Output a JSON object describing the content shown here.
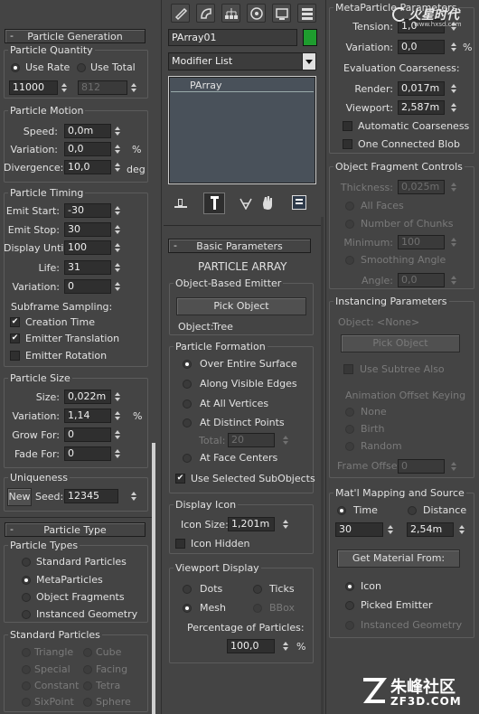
{
  "left": {
    "particle_generation": {
      "title": "Particle Generation"
    },
    "quantity": {
      "title": "Particle Quantity",
      "use_rate": "Use Rate",
      "use_total": "Use Total",
      "rate_value": "11000",
      "total_value": "812"
    },
    "motion": {
      "title": "Particle Motion",
      "speed_label": "Speed:",
      "speed": "0,0m",
      "variation_label": "Variation:",
      "variation": "0,0",
      "variation_unit": "%",
      "divergence_label": "Divergence:",
      "divergence": "10,0",
      "divergence_unit": "deg"
    },
    "timing": {
      "title": "Particle Timing",
      "emit_start_label": "Emit Start:",
      "emit_start": "-30",
      "emit_stop_label": "Emit Stop:",
      "emit_stop": "30",
      "display_until_label": "Display Until:",
      "display_until": "100",
      "life_label": "Life:",
      "life": "31",
      "variation_label": "Variation:",
      "variation": "0",
      "subframe_label": "Subframe Sampling:",
      "creation_time": "Creation Time",
      "emitter_translation": "Emitter Translation",
      "emitter_rotation": "Emitter Rotation"
    },
    "size": {
      "title": "Particle Size",
      "size_label": "Size:",
      "size": "0,022m",
      "variation_label": "Variation:",
      "variation": "1,14",
      "variation_unit": "%",
      "grow_label": "Grow For:",
      "grow": "0",
      "fade_label": "Fade For:",
      "fade": "0"
    },
    "uniqueness": {
      "title": "Uniqueness",
      "new_button": "New",
      "seed_label": "Seed:",
      "seed": "12345"
    },
    "particle_type": {
      "title": "Particle Type"
    },
    "types": {
      "title": "Particle Types",
      "standard": "Standard Particles",
      "meta": "MetaParticles",
      "fragments": "Object Fragments",
      "instanced": "Instanced Geometry"
    },
    "standard": {
      "title": "Standard Particles",
      "triangle": "Triangle",
      "cube": "Cube",
      "special": "Special",
      "facing": "Facing",
      "constant": "Constant",
      "tetra": "Tetra",
      "sixpoint": "SixPoint",
      "sphere": "Sphere"
    }
  },
  "middle": {
    "object_name": "PArray01",
    "object_color": "#1e9c2e",
    "modifier_list": "Modifier List",
    "stack_item": "PArray",
    "basic": {
      "title": "Basic Parameters",
      "heading": "PARTICLE ARRAY"
    },
    "emitter": {
      "title": "Object-Based Emitter",
      "pick_button": "Pick Object",
      "object_label": "Object:",
      "object_value": "Tree"
    },
    "formation": {
      "title": "Particle Formation",
      "over_surface": "Over Entire Surface",
      "visible_edges": "Along Visible Edges",
      "all_vertices": "At All Vertices",
      "distinct_points": "At Distinct Points",
      "total_label": "Total:",
      "total": "20",
      "face_centers": "At Face Centers",
      "use_selected": "Use Selected SubObjects"
    },
    "display_icon": {
      "title": "Display Icon",
      "size_label": "Icon Size:",
      "size": "1,201m",
      "hidden": "Icon Hidden"
    },
    "viewport": {
      "title": "Viewport Display",
      "dots": "Dots",
      "ticks": "Ticks",
      "mesh": "Mesh",
      "bbox": "BBox",
      "percentage_label": "Percentage of Particles:",
      "percentage": "100,0",
      "percentage_unit": "%"
    }
  },
  "right": {
    "meta": {
      "title": "MetaParticle Parameters",
      "tension_label": "Tension:",
      "tension": "1,0",
      "variation_label": "Variation:",
      "variation": "0,0",
      "variation_unit": "%",
      "coarseness_label": "Evaluation Coarseness:",
      "render_label": "Render:",
      "render": "0,017m",
      "viewport_label": "Viewport:",
      "viewport": "2,587m",
      "auto_coarseness": "Automatic Coarseness",
      "one_blob": "One Connected Blob"
    },
    "fragment": {
      "title": "Object Fragment Controls",
      "thickness_label": "Thickness:",
      "thickness": "0,025m",
      "all_faces": "All Faces",
      "num_chunks": "Number of Chunks",
      "minimum_label": "Minimum:",
      "minimum": "100",
      "smoothing": "Smoothing Angle",
      "angle_label": "Angle:",
      "angle": "0,0"
    },
    "instancing": {
      "title": "Instancing Parameters",
      "object_label": "Object: <None>",
      "pick_button": "Pick Object",
      "use_subtree": "Use Subtree Also",
      "offset_label": "Animation Offset Keying",
      "none": "None",
      "birth": "Birth",
      "random": "Random",
      "frame_offset_label": "Frame Offset:",
      "frame_offset": "0"
    },
    "mapping": {
      "title": "Mat'l Mapping and Source",
      "time": "Time",
      "distance": "Distance",
      "time_value": "30",
      "distance_value": "2,54m",
      "get_material": "Get Material From:",
      "icon": "Icon",
      "picked_emitter": "Picked Emitter",
      "instanced_geometry": "Instanced Geometry"
    }
  },
  "watermark_top": "火星时代",
  "watermark_top_url": "www.hxsd.com",
  "watermark_bottom": "朱峰社区",
  "watermark_bottom_url": "ZF3D.COM"
}
